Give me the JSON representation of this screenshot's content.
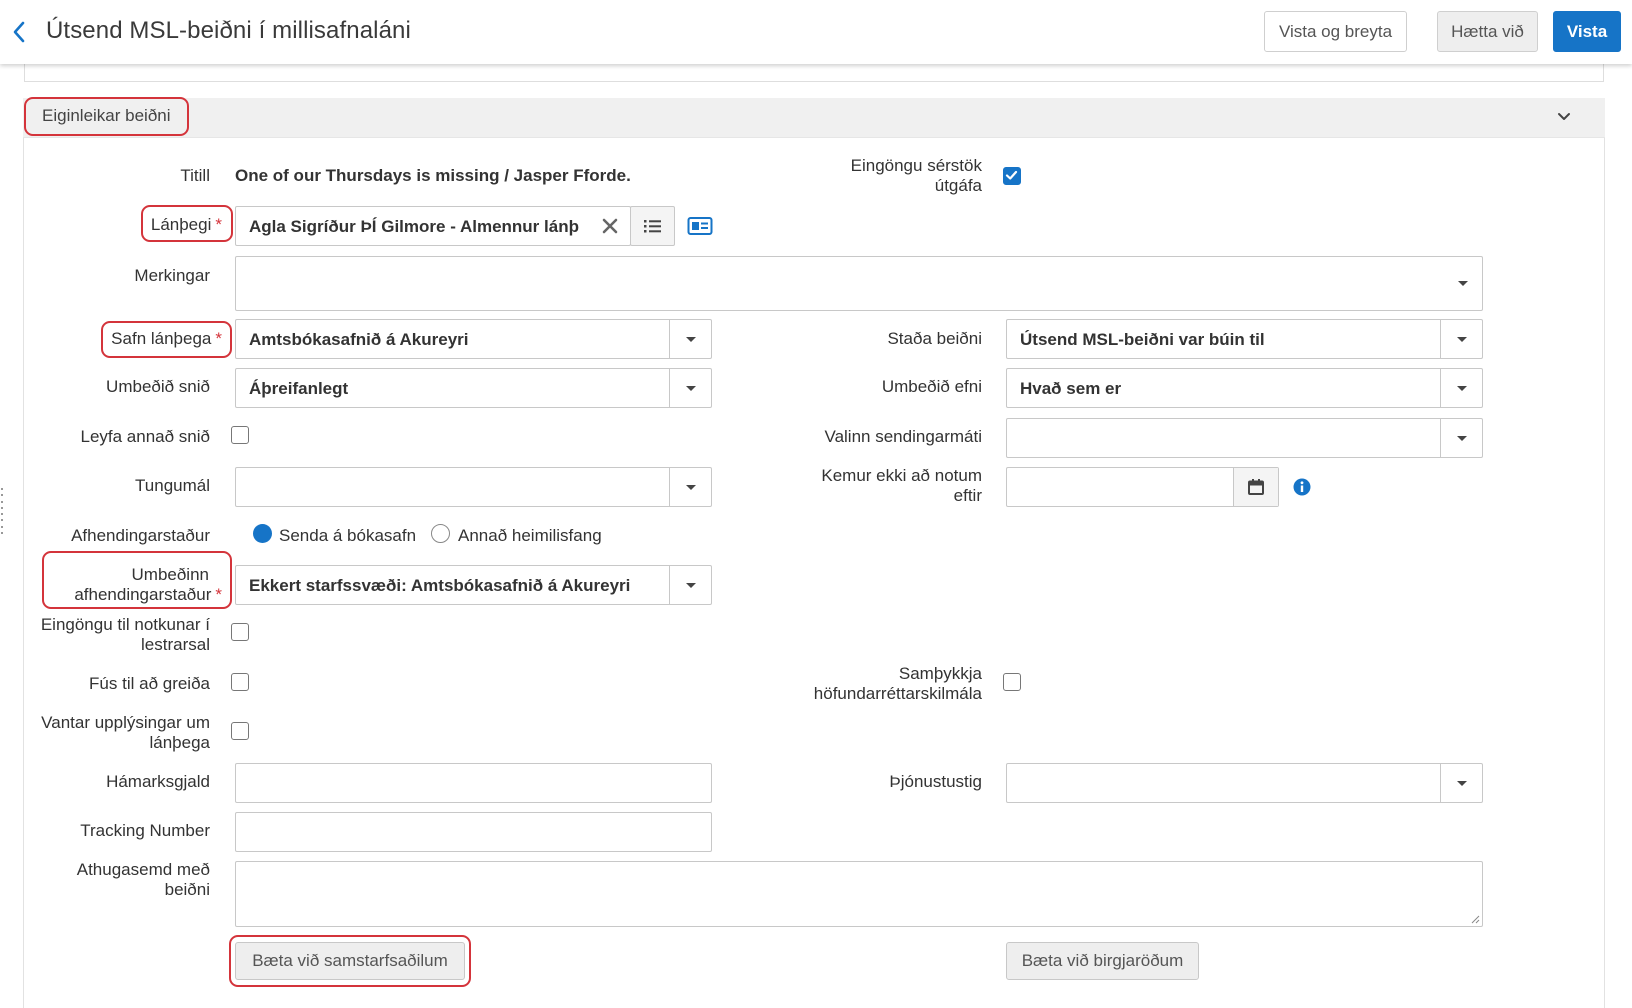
{
  "header": {
    "title": "Útsend MSL-beiðni í millisafnaláni",
    "save_edit_label": "Vista og breyta",
    "cancel_label": "Hætta við",
    "save_label": "Vista"
  },
  "section": {
    "title": "Eiginleikar beiðni"
  },
  "form": {
    "title_label": "Titill",
    "title_value": "One of our Thursdays is missing / Jasper Fforde.",
    "specific_edition_label_1": "Eingöngu sérstök",
    "specific_edition_label_2": "útgáfa",
    "specific_edition_checked": true,
    "patron_label": "Lánþegi",
    "patron_value": "Agla Sigríður ÞÍ Gilmore  - Almennur lánþe",
    "markings_label": "Merkingar",
    "markings_value": "",
    "patron_library_label": "Safn lánþega",
    "patron_library_value": "Amtsbókasafnið á Akureyri",
    "request_status_label": "Staða beiðni",
    "request_status_value": "Útsend MSL-beiðni var búin til",
    "requested_format_label": "Umbeðið snið",
    "requested_format_value": "Áþreifanlegt",
    "requested_material_label": "Umbeðið efni",
    "requested_material_value": "Hvað sem er",
    "allow_other_format_label": "Leyfa annað snið",
    "allow_other_format_checked": false,
    "preferred_send_method_label": "Valinn sendingarmáti",
    "preferred_send_method_value": "",
    "language_label": "Tungumál",
    "language_value": "",
    "not_needed_after_label_1": "Kemur ekki að notum",
    "not_needed_after_label_2": "eftir",
    "not_needed_after_value": "",
    "pickup_location_label": "Afhendingarstaður",
    "pickup_option_library": "Senda á bókasafn",
    "pickup_option_address": "Annað heimilisfang",
    "pickup_selected": "Senda á bókasafn",
    "requested_pickup_label_1": "Umbeðinn",
    "requested_pickup_label_2": "afhendingarstaður",
    "requested_pickup_value": "Ekkert starfssvæði: Amtsbókasafnið á Akureyri",
    "reading_room_label_1": "Eingöngu til notkunar í",
    "reading_room_label_2": "lestrarsal",
    "reading_room_checked": false,
    "willing_to_pay_label": "Fús til að greiða",
    "willing_to_pay_checked": false,
    "accept_copyright_label_1": "Samþykkja",
    "accept_copyright_label_2": "höfundarréttarskilmála",
    "accept_copyright_checked": false,
    "missing_patron_info_label_1": "Vantar upplýsingar um",
    "missing_patron_info_label_2": "lánþega",
    "missing_patron_info_checked": false,
    "max_fee_label": "Hámarksgjald",
    "max_fee_value": "",
    "service_level_label": "Þjónustustig",
    "service_level_value": "",
    "tracking_number_label": "Tracking Number",
    "tracking_number_value": "",
    "request_note_label_1": "Athugasemd með",
    "request_note_label_2": "beiðni",
    "request_note_value": "",
    "add_partners_label": "Bæta við samstarfsaðilum",
    "add_suppliers_label": "Bæta við birgjaröðum"
  },
  "colors": {
    "primary": "#1674c7",
    "required": "#d4343b",
    "highlight": "#d4343b",
    "panel_header": "#f0f0f0"
  },
  "icons": {
    "back": "chevron-left-icon",
    "collapse": "chevron-down-icon",
    "clear": "close-icon",
    "list": "list-icon",
    "card": "contact-card-icon",
    "calendar": "calendar-icon",
    "info": "info-icon"
  }
}
